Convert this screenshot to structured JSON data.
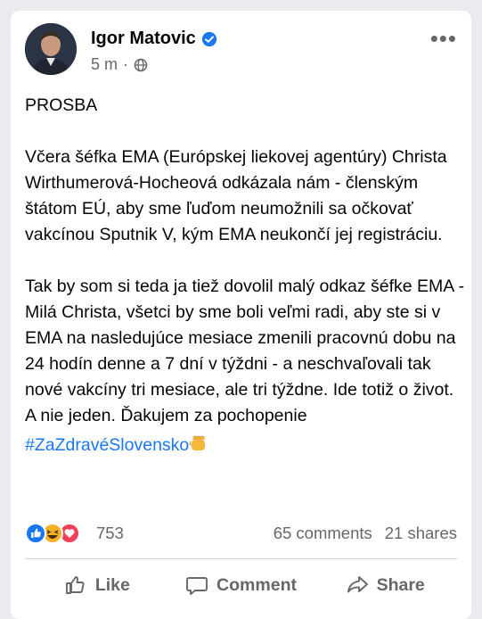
{
  "post": {
    "author": "Igor Matovic",
    "time": "5 m",
    "meta_separator": "·",
    "more_label": "•••",
    "paragraphs": [
      "PROSBA",
      "Včera šéfka EMA (Európskej liekovej agentúry) Christa Wirthumerová-Hocheová odkázala nám - členským štátom EÚ, aby sme ľuďom neumožnili sa očkovať vakcínou Sputnik V, kým EMA neukončí jej registráciu.",
      "Tak by som si teda ja tiež dovolil malý odkaz šéfke EMA - Milá Christa, všetci by sme boli veľmi radi, aby ste si v EMA na nasledujúce mesiace zmenili pracovnú dobu na 24 hodín denne a 7 dní v týždni - a neschvaľovali tak nové vakcíny tri mesiace, ale tri týždne. Ide totiž o život. A nie jeden. Ďakujem za pochopenie"
    ],
    "hashtag": "#ZaZdravéSlovensko"
  },
  "engagement": {
    "reaction_count": "753",
    "comments": "65 comments",
    "shares": "21 shares"
  },
  "actions": {
    "like": "Like",
    "comment": "Comment",
    "share": "Share"
  },
  "icons": {
    "verified": "verified-badge-icon",
    "audience": "globe-icon",
    "reactions": [
      "like-reaction-icon",
      "haha-reaction-icon",
      "love-reaction-icon"
    ],
    "hashtag_emoji": "fist-emoji-icon"
  },
  "colors": {
    "accent": "#1877f2",
    "text": "#050505",
    "secondary": "#65676b"
  }
}
